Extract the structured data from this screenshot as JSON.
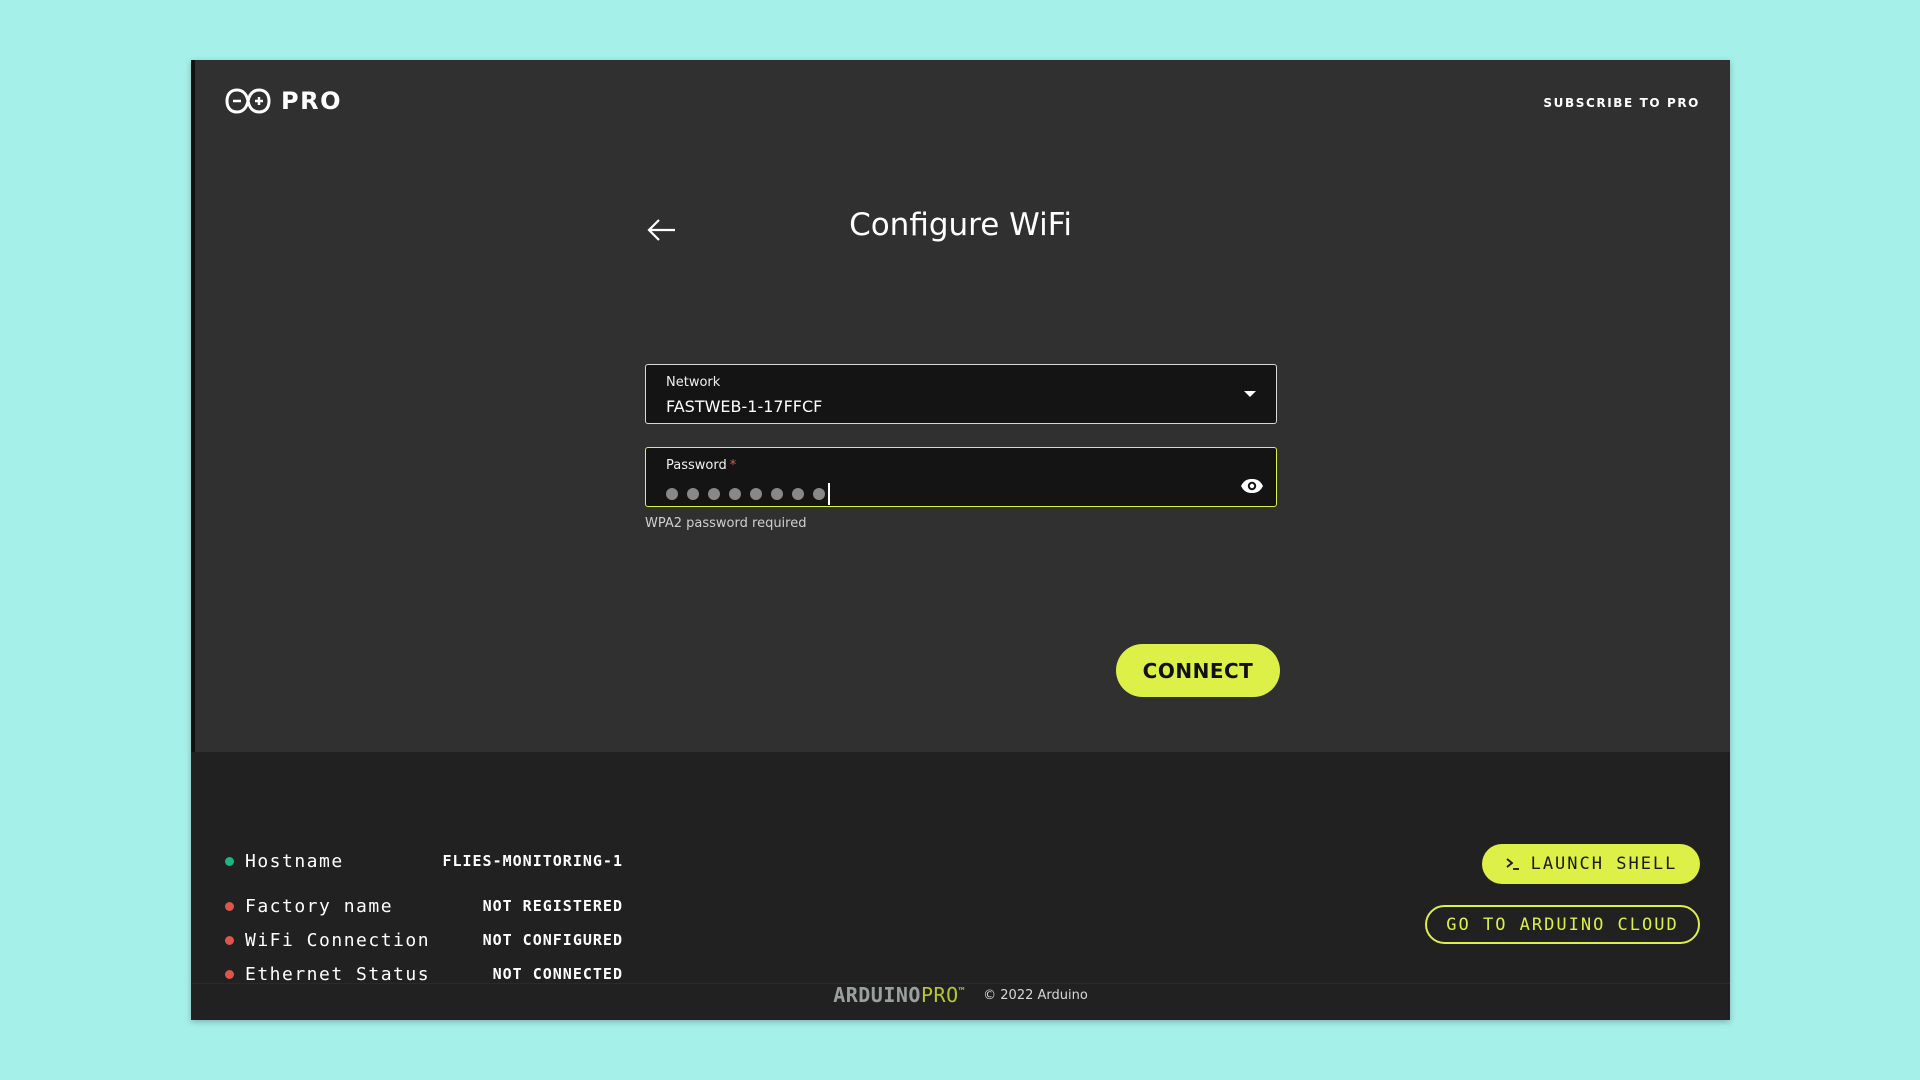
{
  "header": {
    "logo_text": "PRO",
    "subscribe_label": "SUBSCRIBE TO PRO"
  },
  "page": {
    "title": "Configure WiFi"
  },
  "form": {
    "network": {
      "label": "Network",
      "value": "FASTWEB-1-17FFCF"
    },
    "password": {
      "label": "Password",
      "required_mark": "*",
      "masked_length": 8,
      "helper": "WPA2 password required"
    },
    "connect_label": "CONNECT"
  },
  "status": {
    "items": [
      {
        "label": "Hostname",
        "value": "FLIES-MONITORING-1",
        "color": "#1db584"
      },
      {
        "label": "Factory name",
        "value": "NOT REGISTERED",
        "color": "#e0554a"
      },
      {
        "label": "WiFi Connection",
        "value": "NOT CONFIGURED",
        "color": "#e0554a"
      },
      {
        "label": "Ethernet Status",
        "value": "NOT CONNECTED",
        "color": "#e0554a"
      }
    ],
    "launch_shell_label": "LAUNCH SHELL",
    "cloud_label": "GO TO ARDUINO CLOUD"
  },
  "footer": {
    "brand_part1": "ARDUINO",
    "brand_part2": "PRO",
    "trademark": "™",
    "copyright": "© 2022 Arduino"
  },
  "colors": {
    "accent": "#dcf048",
    "background": "#303030",
    "panel": "#212121",
    "ok": "#1db584",
    "error": "#e0554a"
  },
  "icons": {
    "logo": "infinity-logo-icon",
    "back": "arrow-left-icon",
    "dropdown": "caret-down-icon",
    "visibility": "eye-icon",
    "shell": "terminal-prompt-icon"
  }
}
